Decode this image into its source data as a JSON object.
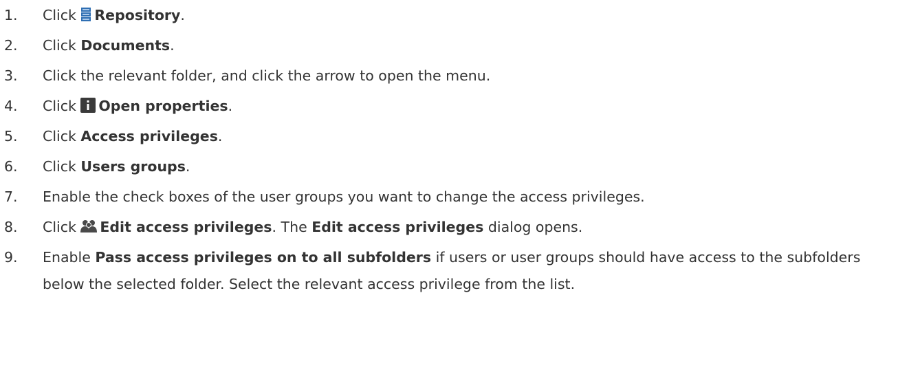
{
  "steps": [
    {
      "n": "1.",
      "pre": "Click ",
      "icon": "repository-icon",
      "bold": "Repository",
      "post": "."
    },
    {
      "n": "2.",
      "pre": "Click ",
      "bold": "Documents",
      "post": "."
    },
    {
      "n": "3.",
      "text": "Click the relevant folder, and click the arrow to open the menu."
    },
    {
      "n": "4.",
      "pre": "Click ",
      "icon": "info-icon",
      "bold": "Open properties",
      "post": "."
    },
    {
      "n": "5.",
      "pre": "Click ",
      "bold": "Access privileges",
      "post": "."
    },
    {
      "n": "6.",
      "pre": "Click ",
      "bold": "Users groups",
      "post": "."
    },
    {
      "n": "7.",
      "text": "Enable the check boxes of the user groups you want to change the access privileges."
    },
    {
      "n": "8.",
      "pre": "Click ",
      "icon": "users-icon",
      "bold": "Edit access privileges",
      "mid": ". The ",
      "bold2": "Edit access privileges",
      "post": " dialog opens."
    },
    {
      "n": "9.",
      "pre": "Enable ",
      "bold": "Pass access privileges on to all subfolders",
      "post": " if users or user groups should have access to the subfolders below the selected folder. Select the relevant access privilege from the list."
    }
  ],
  "colors": {
    "text": "#333333",
    "repository_icon": "#2f6fb3",
    "info_icon": "#3a3a3a",
    "users_icon": "#4a4a4a"
  }
}
